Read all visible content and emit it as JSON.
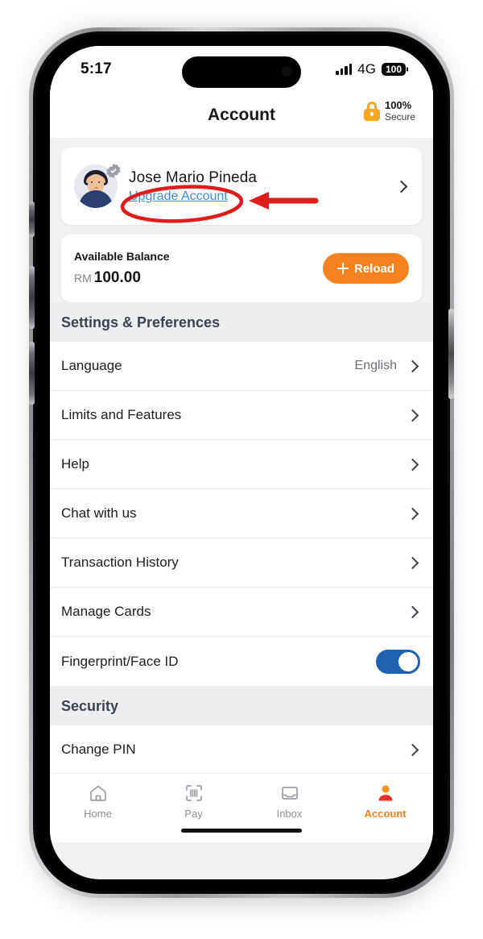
{
  "status_bar": {
    "time": "5:17",
    "network": "4G",
    "battery": "100",
    "signal_icon": "signal-bars-icon",
    "island": "dynamic-island"
  },
  "header": {
    "title": "Account",
    "secure_icon": "lock-icon",
    "secure_percent": "100%",
    "secure_label": "Secure"
  },
  "profile": {
    "name": "Jose Mario Pineda",
    "upgrade_link": "Upgrade Account",
    "verified_icon": "verified-badge-icon",
    "avatar_icon": "avatar",
    "chevron_icon": "chevron-right-icon"
  },
  "balance": {
    "label": "Available Balance",
    "currency": "RM",
    "amount": "100.00",
    "reload_label": "Reload",
    "plus_icon": "plus-icon"
  },
  "sections": [
    {
      "title": "Settings & Preferences",
      "rows": [
        {
          "label": "Language",
          "value": "English"
        },
        {
          "label": "Limits and Features",
          "value": ""
        },
        {
          "label": "Help",
          "value": ""
        },
        {
          "label": "Chat with us",
          "value": ""
        },
        {
          "label": "Transaction History",
          "value": ""
        },
        {
          "label": "Manage Cards",
          "value": ""
        },
        {
          "label": "Fingerprint/Face ID",
          "value": "",
          "control": "toggle",
          "toggle_on": true
        }
      ]
    },
    {
      "title": "Security",
      "rows": [
        {
          "label": "Change PIN",
          "value": ""
        }
      ]
    }
  ],
  "tabs": [
    {
      "label": "Home",
      "icon": "home-icon",
      "active": false
    },
    {
      "label": "Pay",
      "icon": "scan-pay-icon",
      "active": false
    },
    {
      "label": "Inbox",
      "icon": "inbox-icon",
      "active": false
    },
    {
      "label": "Account",
      "icon": "person-icon",
      "active": true
    }
  ],
  "annotations": {
    "ellipse": "red-ellipse-highlight",
    "arrow": "red-arrow-pointer",
    "color": "#e01b1b"
  },
  "colors": {
    "accent_orange": "#f58220",
    "link_blue": "#3a8dde",
    "toggle_blue": "#1f63b0",
    "lock_amber": "#f5a623",
    "section_bg": "#eceef0"
  }
}
